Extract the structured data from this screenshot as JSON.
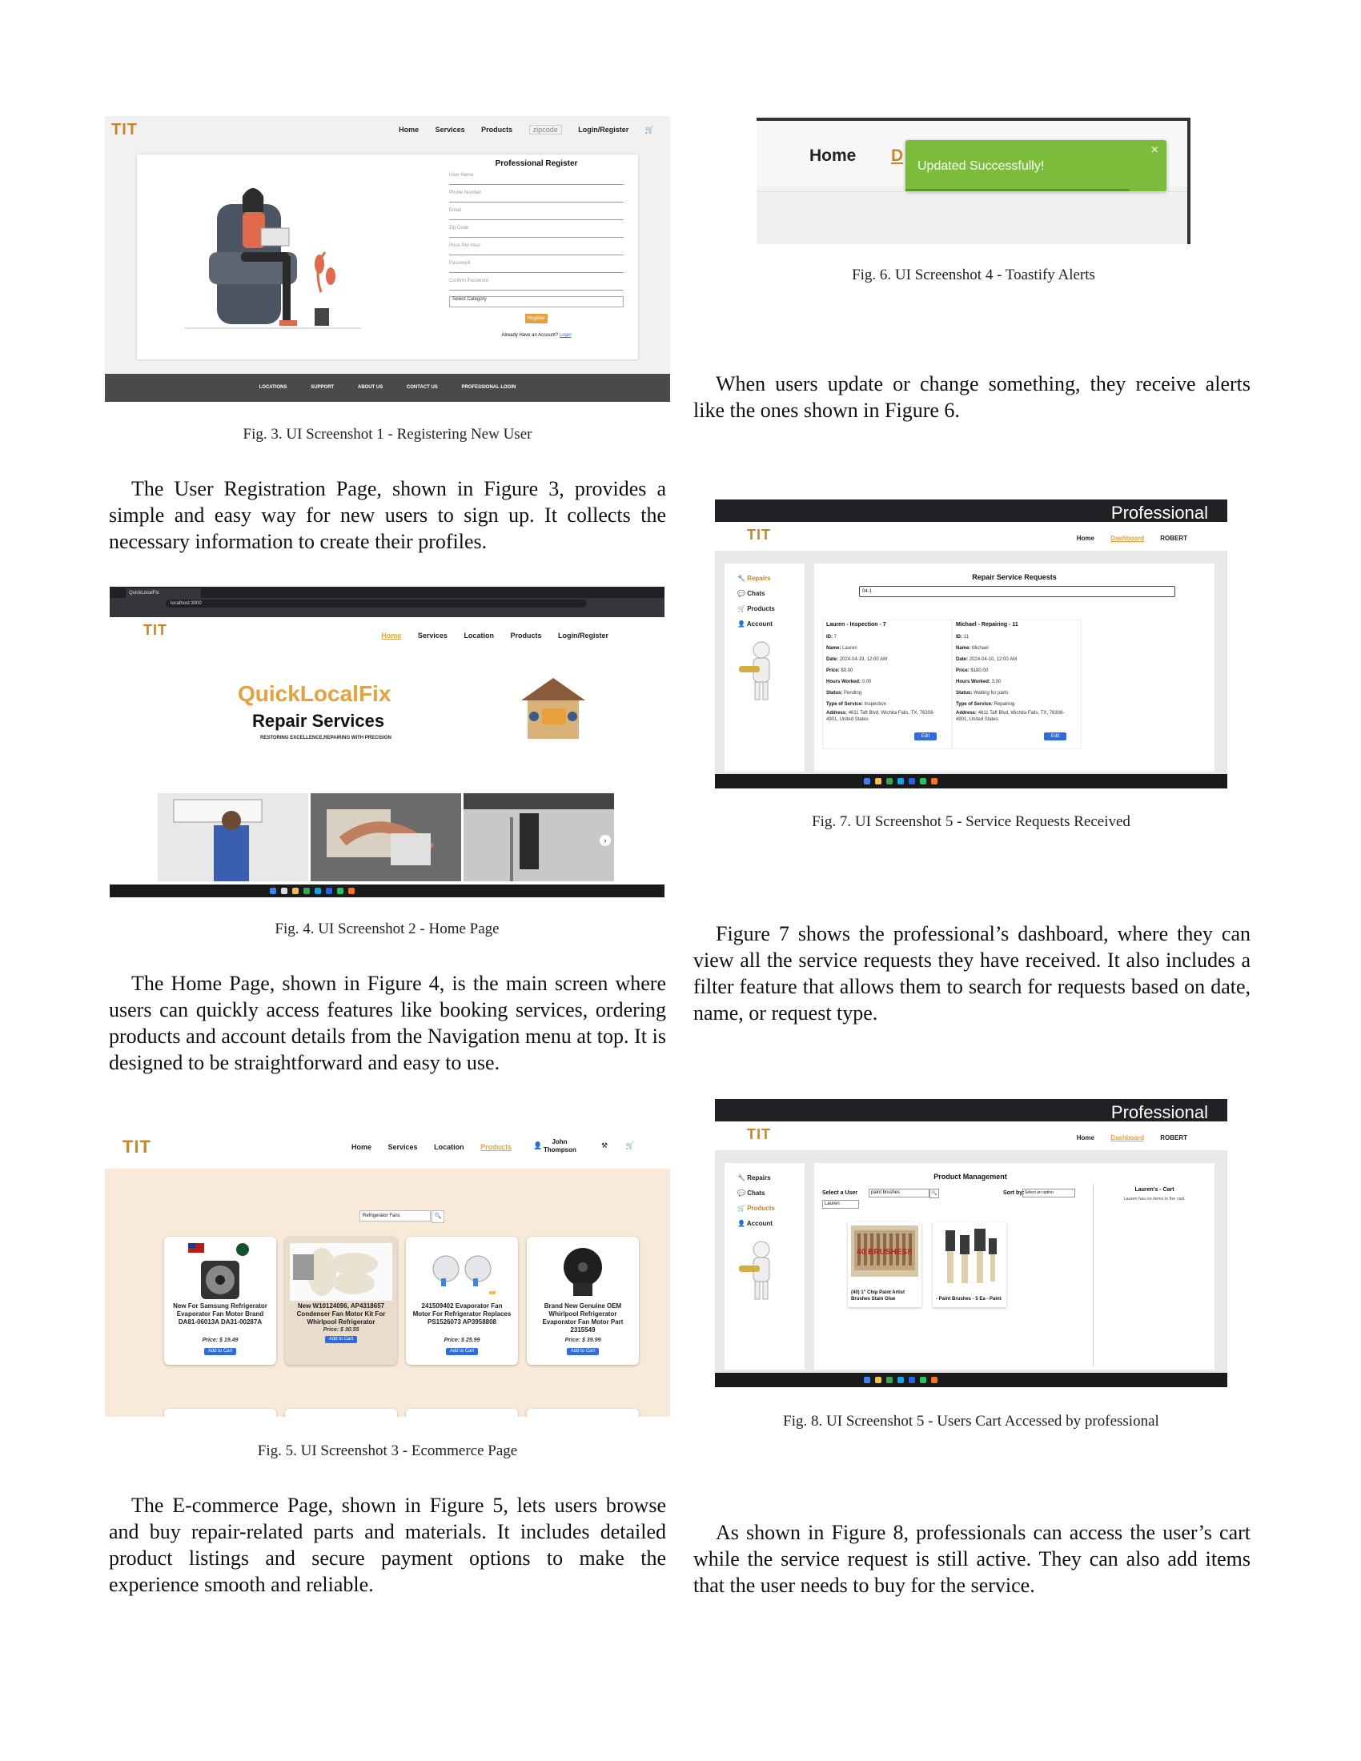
{
  "fig3": {
    "nav": [
      "Home",
      "Services",
      "Products",
      "zipcode",
      "Login/Register"
    ],
    "form_title": "Professional Register",
    "fields": [
      "User Name",
      "Phone Number",
      "Email",
      "Zip Code",
      "Price Per Hour",
      "Password",
      "Confirm Password"
    ],
    "select": "Select Category",
    "button": "Register",
    "login_prefix": "Already Have an Account?",
    "login_link": "Login",
    "footer": [
      "LOCATIONS",
      "SUPPORT",
      "ABOUT US",
      "CONTACT US",
      "PROFESSIONAL LOGIN"
    ],
    "caption": "Fig. 3.  UI Screenshot 1 - Registering New User"
  },
  "para1": "The User Registration Page, shown in Figure 3, provides a simple and easy way for new users to sign up. It collects the necessary information to create their profiles.",
  "fig4": {
    "tab": "QuickLocalFix",
    "url": "localhost:3000",
    "nav": [
      "Home",
      "Services",
      "Location",
      "Products",
      "Login/Register"
    ],
    "brand": "QuickLocalFix",
    "headline": "Repair Services",
    "tagline": "RESTORING EXCELLENCE,REPAIRING WITH PRECISION",
    "caption": "Fig. 4.  UI Screenshot 2 - Home Page"
  },
  "para2": "The Home Page, shown in Figure 4, is the main screen where users can quickly access features like booking services, ordering products and account details from the Navigation menu at top. It is designed to be straightforward and easy to use.",
  "fig5": {
    "nav": [
      "Home",
      "Services",
      "Location",
      "Products"
    ],
    "user": "John Thompson",
    "search": "Refrigerator Fans",
    "products": [
      {
        "title": "New For Samsung Refrigerator Evaporator Fan Motor Brand DA81-06013A DA31-00287A",
        "price": "Price: $ 19.49"
      },
      {
        "title": "New W10124096, AP4318657 Condenser Fan Motor Kit For Whirlpool Refrigerator",
        "price": "Price: $ 30.55"
      },
      {
        "title": "241509402 Evaporator Fan Motor For Refrigerator Replaces PS1526073 AP3958808",
        "price": "Price: $ 25.99"
      },
      {
        "title": "Brand New Genuine OEM Whirlpool Refrigerator Evaporator Fan Motor Part 2315549",
        "price": "Price: $ 39.99"
      }
    ],
    "add_label": "Add to Cart",
    "caption": "Fig. 5.  UI Screenshot 3 - Ecommerce Page"
  },
  "para3": "The E-commerce Page, shown in Figure 5, lets users browse and buy repair-related parts and materials. It includes detailed product listings and secure payment options to make the experience smooth and reliable.",
  "fig6": {
    "home": "Home",
    "partial": "D",
    "toast": "Updated Successfully!",
    "close": "×",
    "caption": "Fig. 6.  UI Screenshot 4 - Toastify Alerts"
  },
  "para4": "When users update or change something, they receive alerts like the ones shown in Figure 6.",
  "fig7": {
    "overlay": "Professional",
    "nav": [
      "Home",
      "Dashboard",
      "ROBERT"
    ],
    "sidebar": [
      "Repairs",
      "Chats",
      "Products",
      "Account"
    ],
    "title": "Repair Service Requests",
    "search": "04-1",
    "requests": [
      {
        "header": "Lauren - Inspection - 7",
        "id": "7",
        "name": "Lauren",
        "date": "2024-04-19, 12:00 AM",
        "price": "$0.00",
        "hours": "0.00",
        "status": "Pending",
        "type": "Inspection",
        "address": "4611 Taft Blvd, Wichita Falls, TX, 76308-4901, United States"
      },
      {
        "header": "Michael - Repairing - 11",
        "id": "11",
        "name": "Michael",
        "date": "2024-04-10, 12:00 AM",
        "price": "$180.00",
        "hours": "3.00",
        "status": "Waiting for parts",
        "type": "Repairing",
        "address": "4611 Taft Blvd, Wichita Falls, TX, 76308-4901, United States"
      }
    ],
    "labels": {
      "id": "ID:",
      "name": "Name:",
      "date": "Date:",
      "price": "Price:",
      "hours": "Hours Worked:",
      "status": "Status:",
      "type": "Type of Service:",
      "address": "Address:"
    },
    "edit": "Edit",
    "caption": "Fig. 7.  UI Screenshot 5 - Service Requests Received"
  },
  "para5": "Figure 7 shows the professional’s dashboard, where they can view all the service requests they have received. It also includes a filter feature that allows them to search for requests based on date, name, or request type.",
  "fig8": {
    "overlay": "Professional",
    "nav": [
      "Home",
      "Dashboard",
      "ROBERT"
    ],
    "sidebar": [
      "Repairs",
      "Chats",
      "Products",
      "Account"
    ],
    "title": "Product Management",
    "select_user_label": "Select a User",
    "user_value": "Lauren",
    "search": "paint brushes",
    "sort_label": "Sort by:",
    "sort_value": "Select an option",
    "cart_title": "Lauren's - Cart",
    "cart_empty": "Lauren has no items in the cart.",
    "brush_text": "40 BRUSHES!!",
    "items": [
      "(40) 1\" Chip Paint Artist Brushes Stain Glue",
      "- Paint Brushes - 5 Ea - Paint"
    ],
    "caption": "Fig. 8.  UI Screenshot 5 - Users Cart Accessed by professional"
  },
  "para6": "As shown in Figure 8, professionals can access the user’s cart while the service request is still active. They can also add items that the user needs to buy for the service.",
  "colors": {
    "brand": "#c9852a",
    "toast": "#7bbd3a",
    "link": "#2d6be0",
    "footer": "#4a4a4a"
  }
}
